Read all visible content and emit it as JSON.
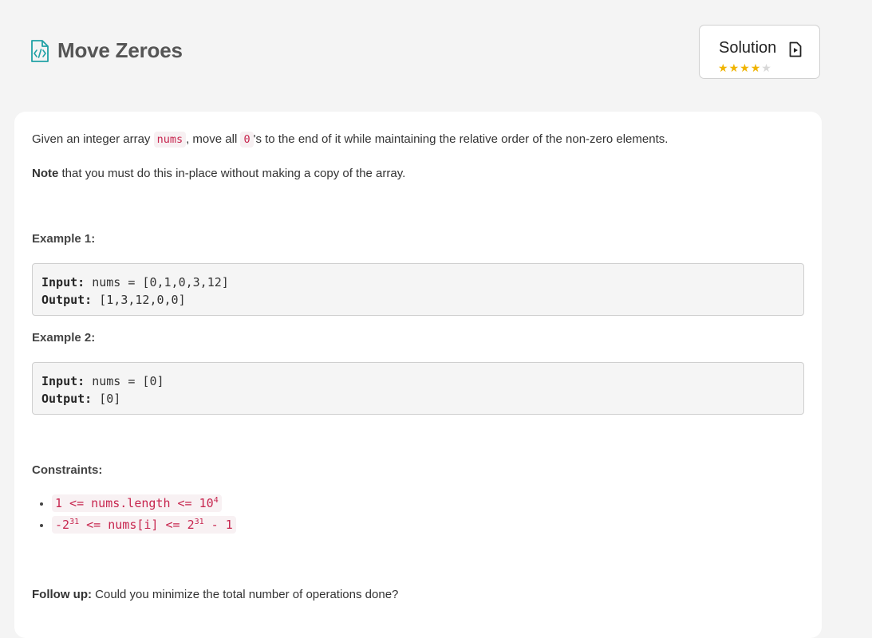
{
  "problem": {
    "title": "Move Zeroes"
  },
  "solution": {
    "label": "Solution",
    "rating": 4,
    "max_rating": 5
  },
  "description": {
    "p1_before": "Given an integer array ",
    "p1_code1": "nums",
    "p1_middle": ", move all ",
    "p1_code2": "0",
    "p1_after": "'s to the end of it while maintaining the relative order of the non-zero elements.",
    "note_bold": "Note",
    "note_text": " that you must do this in-place without making a copy of the array."
  },
  "examples": [
    {
      "heading": "Example 1:",
      "input_label": "Input:",
      "input_value": "nums = [0,1,0,3,12]",
      "output_label": "Output:",
      "output_value": "[1,3,12,0,0]"
    },
    {
      "heading": "Example 2:",
      "input_label": "Input:",
      "input_value": "nums = [0]",
      "output_label": "Output:",
      "output_value": "[0]"
    }
  ],
  "constraints": {
    "heading": "Constraints:",
    "c1_text": "1 <= nums.length <= 10",
    "c1_sup": "4",
    "c2_a": "-2",
    "c2_sup1": "31",
    "c2_b": " <= nums[i] <= 2",
    "c2_sup2": "31",
    "c2_c": " - 1"
  },
  "follow_up": {
    "bold": "Follow up:",
    "text": " Could you minimize the total number of operations done?"
  },
  "colors": {
    "accent_icon": "#21a1a5",
    "star_on": "#f0b400",
    "star_off": "#d8d8d8",
    "code_text": "#c7254e"
  },
  "icons": {
    "title": "code-file-icon",
    "solution": "solution-doc-icon",
    "rating": "star-icon"
  }
}
